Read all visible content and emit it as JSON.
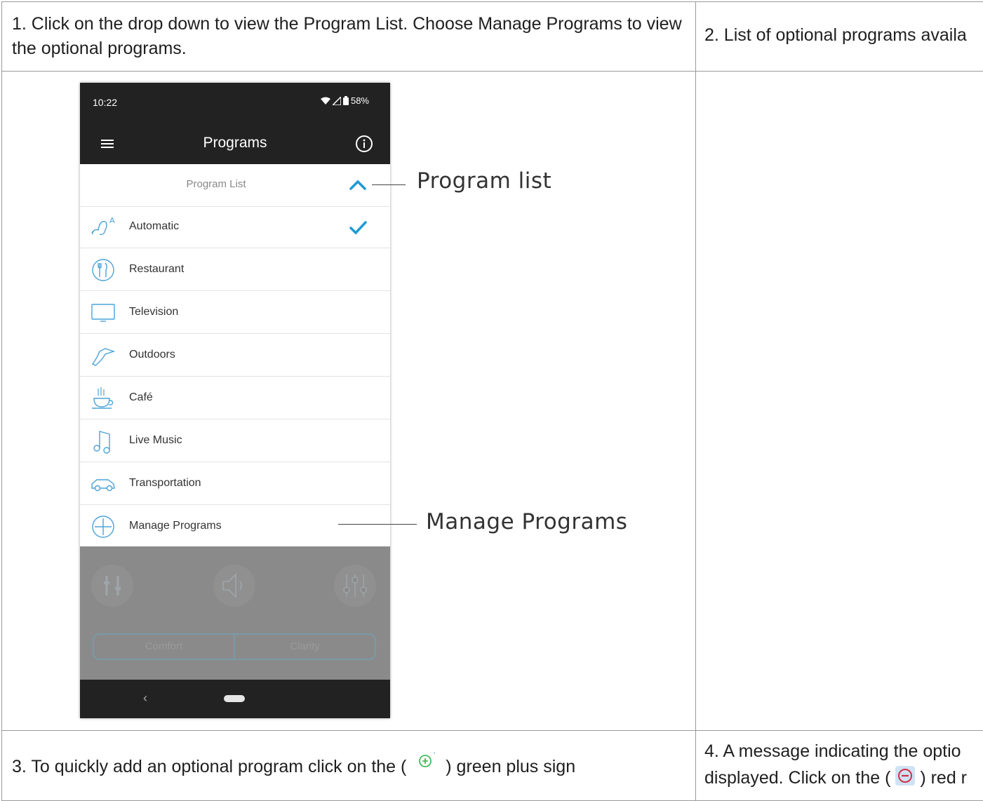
{
  "steps": {
    "step1": "1. Click on the drop down to view the Program List. Choose Manage Programs to view the optional programs.",
    "step2": "2. List of optional programs availa",
    "step3_before": "3. To quickly add an optional program click on the (",
    "step3_after": ") green plus sign",
    "step4_line1": "4. A message indicating the optio",
    "step4_line2_before": "displayed. Click on the (",
    "step4_line2_after": ") red r"
  },
  "phone": {
    "status_time": "10:22",
    "battery": "58%",
    "title": "Programs",
    "program_list_label": "Program List",
    "programs": [
      {
        "label": "Automatic",
        "icon": "automatic-icon",
        "selected": true
      },
      {
        "label": "Restaurant",
        "icon": "restaurant-icon",
        "selected": false
      },
      {
        "label": "Television",
        "icon": "television-icon",
        "selected": false
      },
      {
        "label": "Outdoors",
        "icon": "outdoors-icon",
        "selected": false
      },
      {
        "label": "Café",
        "icon": "cafe-icon",
        "selected": false
      },
      {
        "label": "Live Music",
        "icon": "music-icon",
        "selected": false
      },
      {
        "label": "Transportation",
        "icon": "car-icon",
        "selected": false
      },
      {
        "label": "Manage Programs",
        "icon": "plus-circle-icon",
        "selected": false
      }
    ],
    "segments": [
      "Comfort",
      "Clarity"
    ],
    "nav_back": "‹"
  },
  "callouts": {
    "program_list": "Program list",
    "manage_programs": "Manage Programs"
  },
  "colors": {
    "accent": "#1e9ad6",
    "dark_bar": "#222222",
    "green_plus": "#2fb24a",
    "red_minus": "#d0304a"
  }
}
